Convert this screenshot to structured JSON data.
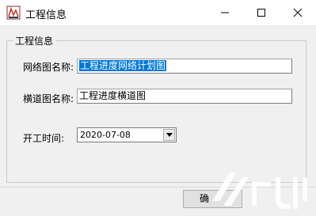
{
  "window": {
    "title": "工程信息"
  },
  "group": {
    "label": "工程信息"
  },
  "fields": {
    "network_label": "网络图名称:",
    "network_value": "工程进度网络计划图",
    "cross_label": "横道图名称:",
    "cross_value": "工程进度横道图",
    "start_label": "开工时间:",
    "start_value": "2020-07-08"
  },
  "buttons": {
    "ok_partial": "确"
  },
  "icons": [
    "app-icon",
    "minimize-icon",
    "maximize-icon",
    "close-icon",
    "dropdown-arrow-icon"
  ],
  "colors": {
    "selection": "#0078d7",
    "window_bg": "#f0f0f0",
    "titlebar_bg": "#ffffff"
  }
}
